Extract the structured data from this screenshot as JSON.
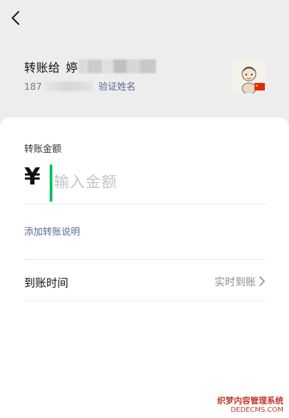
{
  "nav": {
    "back_icon": "chevron-left-icon"
  },
  "recipient": {
    "prefix": "转账给",
    "name_visible": "婷",
    "phone_prefix": "187",
    "verify_link": "验证姓名",
    "avatar_icon": "cartoon-avatar-icon",
    "flag_icon": "china-flag-icon"
  },
  "form": {
    "amount_label": "转账金额",
    "currency_symbol": "¥",
    "amount_placeholder": "输入金额",
    "add_note_link": "添加转账说明",
    "arrival_label": "到账时间",
    "arrival_value": "实时到账",
    "chevron_icon": "chevron-right-icon"
  },
  "watermark": {
    "line1": "织梦内容管理系统",
    "line2": "DEDECMS.COM"
  },
  "colors": {
    "accent_green": "#07c160",
    "link_blue": "#576b95",
    "background": "#ededed"
  }
}
